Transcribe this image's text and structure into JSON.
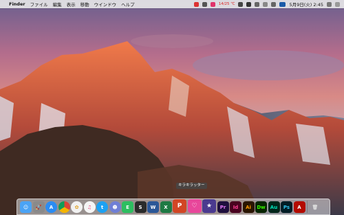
{
  "menubar": {
    "apple_glyph": "",
    "app_name": "Finder",
    "menus": [
      "ファイル",
      "編集",
      "表示",
      "移動",
      "ウインドウ",
      "ヘルプ"
    ],
    "battery_text": "14/25 ℃",
    "date_time": "5月9日(火) 2:45"
  },
  "dock": {
    "tooltip": "キラキラッター",
    "apps": [
      {
        "name": "finder-icon",
        "glyph": "☺",
        "color": "#4aa3f5"
      },
      {
        "name": "launchpad-icon",
        "glyph": "🚀",
        "color": "#8a8a8a"
      },
      {
        "name": "app-store-icon",
        "glyph": "A",
        "color": "#2b8cf3"
      },
      {
        "name": "chrome-icon",
        "glyph": "",
        "color": "#e9e9e9"
      },
      {
        "name": "photos-icon",
        "glyph": "✿",
        "color": "#f1f1f1"
      },
      {
        "name": "itunes-icon",
        "glyph": "♫",
        "color": "#f5f5f5"
      },
      {
        "name": "twitter-icon",
        "glyph": "t",
        "color": "#1da1f2"
      },
      {
        "name": "discord-icon",
        "glyph": "☻",
        "color": "#6f7fd6"
      },
      {
        "name": "evernote-icon",
        "glyph": "E",
        "color": "#2dbe60"
      },
      {
        "name": "sublime-icon",
        "glyph": "S",
        "color": "#2b2b2b"
      },
      {
        "name": "word-icon",
        "glyph": "W",
        "color": "#2b5797"
      },
      {
        "name": "excel-icon",
        "glyph": "X",
        "color": "#1f7a44"
      },
      {
        "name": "powerpoint-icon",
        "glyph": "P",
        "color": "#d24625"
      },
      {
        "name": "kirakiratter-icon",
        "glyph": "♡",
        "color": "#e8479b"
      },
      {
        "name": "imovie-icon",
        "glyph": "★",
        "color": "#4b3a8f"
      },
      {
        "name": "premiere-icon",
        "glyph": "Pr",
        "color": "#1f0f3d"
      },
      {
        "name": "indesign-icon",
        "glyph": "Id",
        "color": "#49021f"
      },
      {
        "name": "illustrator-icon",
        "glyph": "Ai",
        "color": "#2a1500"
      },
      {
        "name": "dreamweaver-icon",
        "glyph": "Dw",
        "color": "#072401"
      },
      {
        "name": "audition-icon",
        "glyph": "Au",
        "color": "#00251a"
      },
      {
        "name": "photoshop-icon",
        "glyph": "Ps",
        "color": "#001d26"
      },
      {
        "name": "acrobat-icon",
        "glyph": "A",
        "color": "#b30b00"
      },
      {
        "name": "trash-icon",
        "glyph": "🗑",
        "color": "transparent"
      }
    ],
    "text_colors": {
      "premiere-icon": "#e579f5",
      "indesign-icon": "#ff3f94",
      "illustrator-icon": "#ff9a00",
      "dreamweaver-icon": "#35fa00",
      "audition-icon": "#00e4bb",
      "photoshop-icon": "#31c5f0"
    }
  }
}
